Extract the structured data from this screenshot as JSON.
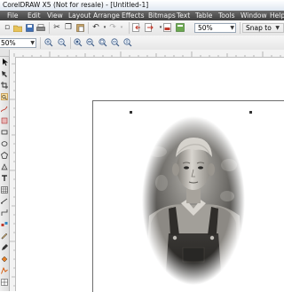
{
  "window": {
    "title": "CorelDRAW X5 (Not for resale) - [Untitled-1]"
  },
  "menu": [
    "File",
    "Edit",
    "View",
    "Layout",
    "Arrange",
    "Effects",
    "Bitmaps",
    "Text",
    "Table",
    "Tools",
    "Window",
    "Help"
  ],
  "standard_toolbar": {
    "zoom_level": "50%",
    "snap_to": "Snap to"
  },
  "property_bar": {
    "zoom_level": "50%"
  },
  "canvas": {
    "image_subject": "vignetted sepia portrait of a boy in overalls"
  }
}
